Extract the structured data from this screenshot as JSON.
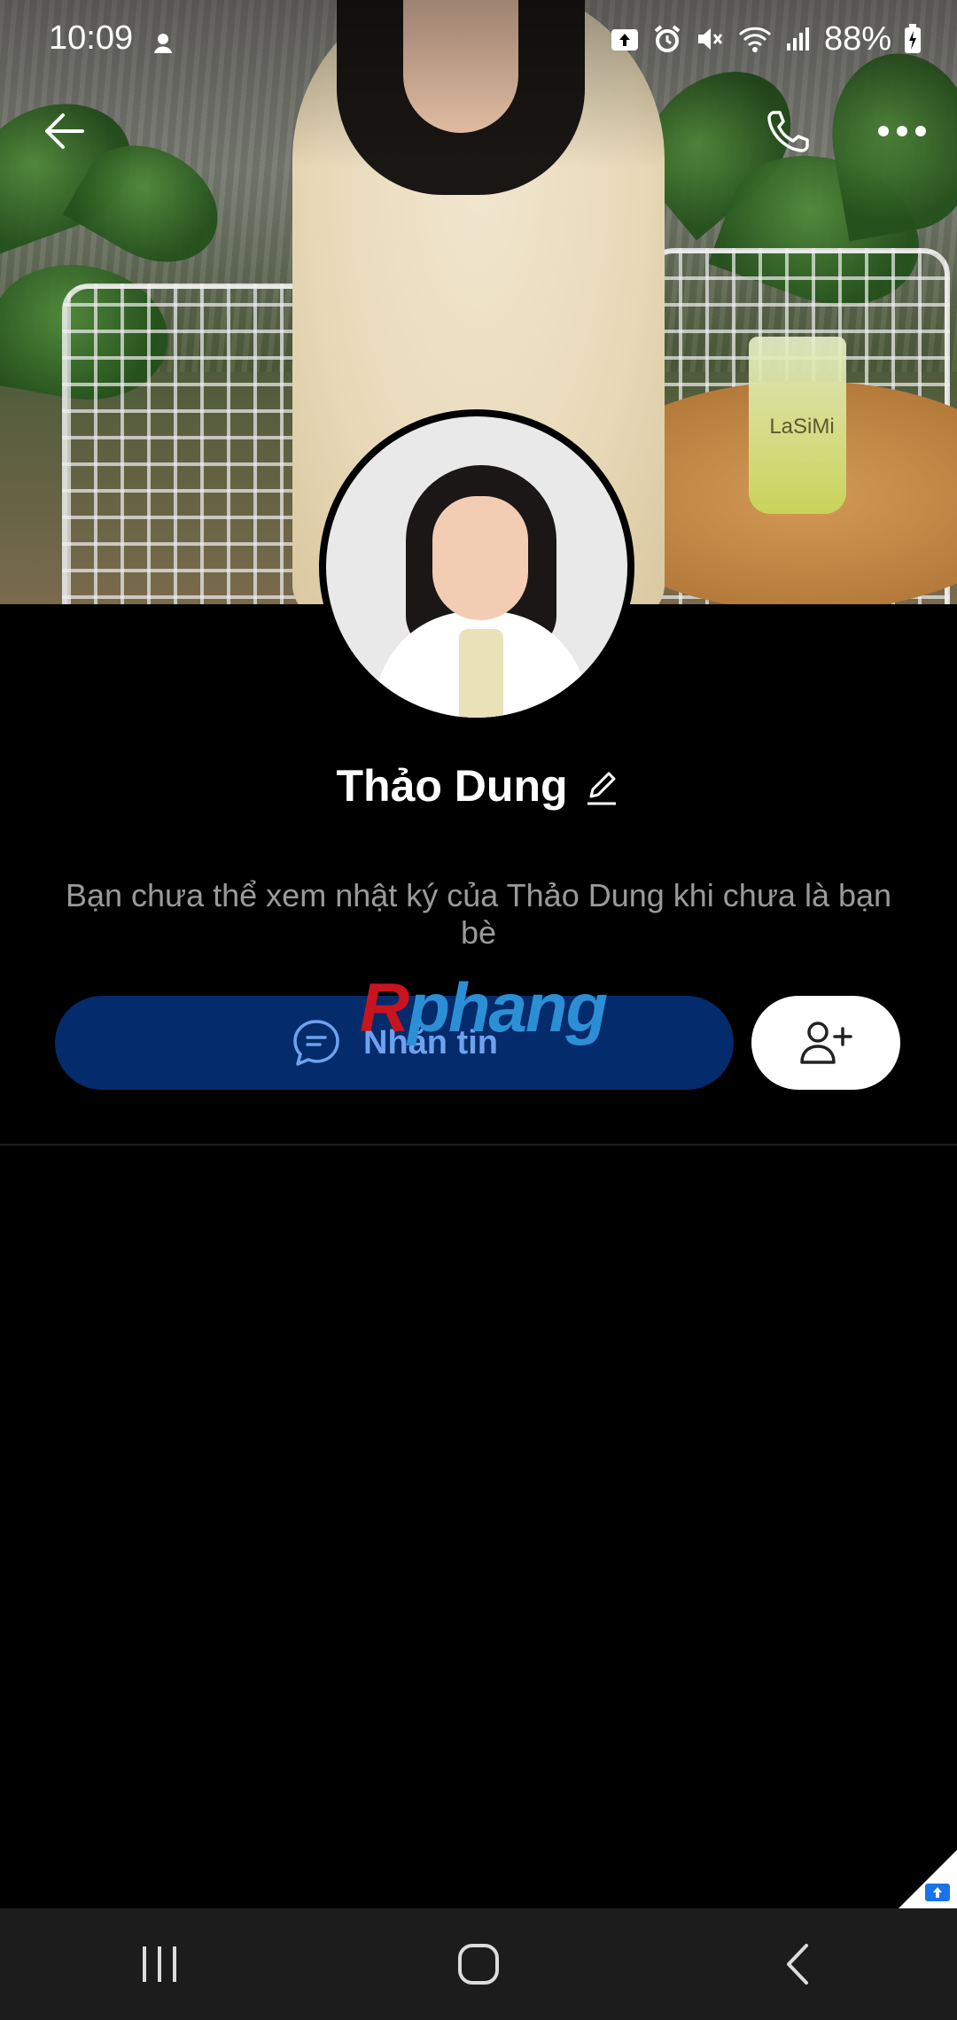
{
  "status_bar": {
    "time": "10:09",
    "battery": "88%"
  },
  "cover": {
    "cup_label": "LaSiMi"
  },
  "profile": {
    "name": "Thảo Dung",
    "info_text": "Bạn chưa thể xem nhật ký của Thảo Dung khi chưa là bạn bè"
  },
  "actions": {
    "message_label": "Nhắn tin"
  },
  "watermark": {
    "first": "R",
    "rest": "phang"
  },
  "icons": {
    "back": "arrow-left-icon",
    "call": "phone-icon",
    "more": "more-horizontal-icon",
    "edit": "pencil-icon",
    "message": "chat-bubble-icon",
    "add_friend": "add-user-icon",
    "nav_recents": "recents-icon",
    "nav_home": "home-icon",
    "nav_back": "back-icon"
  },
  "colors": {
    "message_button_bg": "#042b6b",
    "message_button_text": "#6fa2ee",
    "info_text": "#9a9a9a"
  }
}
